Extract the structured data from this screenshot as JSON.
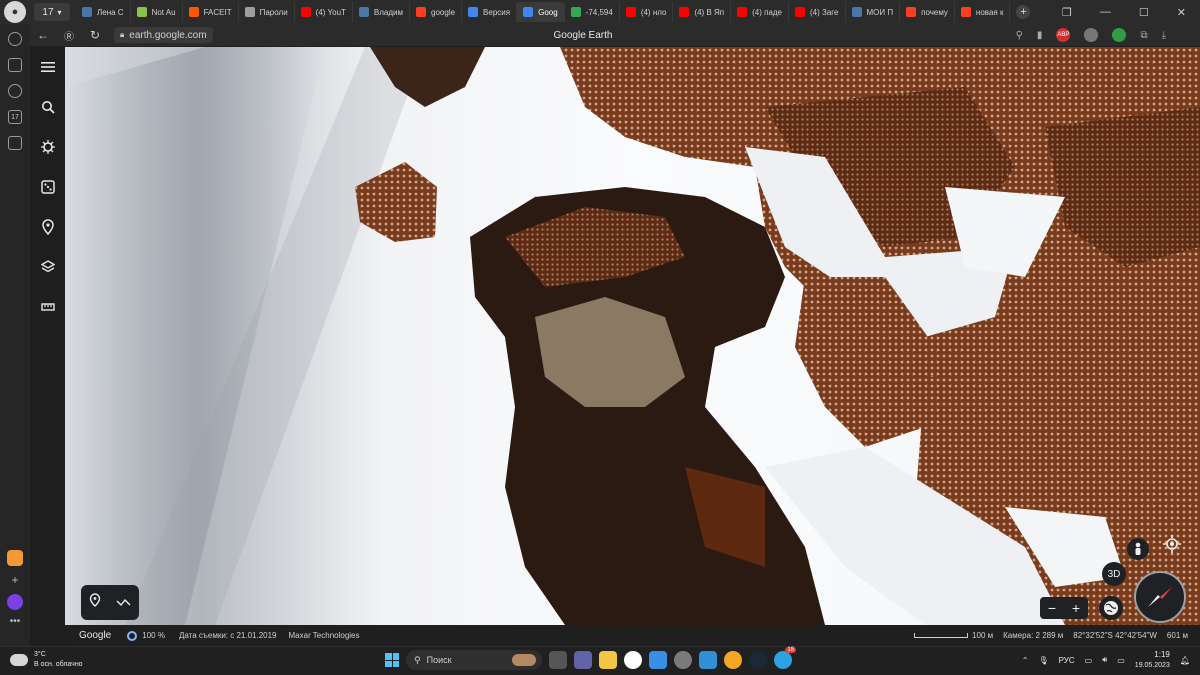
{
  "browser": {
    "tab_count": "17",
    "tabs": [
      {
        "label": "Лена С",
        "color": "#4a76a8"
      },
      {
        "label": "Not Au",
        "color": "#8bc34a"
      },
      {
        "label": "FACEIT",
        "color": "#ff5500"
      },
      {
        "label": "Пароли",
        "color": "#9e9e9e"
      },
      {
        "label": "(4) YouT",
        "color": "#ff0000"
      },
      {
        "label": "Владим",
        "color": "#4a76a8"
      },
      {
        "label": "google",
        "color": "#fc3f1d"
      },
      {
        "label": "Версия",
        "color": "#4285f4"
      },
      {
        "label": "Goog",
        "color": "#4285f4",
        "active": true
      },
      {
        "label": "-74,594",
        "color": "#34a853"
      },
      {
        "label": "(4) нло",
        "color": "#ff0000"
      },
      {
        "label": "(4) В Яп",
        "color": "#ff0000"
      },
      {
        "label": "(4) паде",
        "color": "#ff0000"
      },
      {
        "label": "(4) Заге",
        "color": "#ff0000"
      },
      {
        "label": "МОИ П",
        "color": "#4a76a8"
      },
      {
        "label": "почему",
        "color": "#fc3f1d"
      },
      {
        "label": "новая к",
        "color": "#fc3f1d"
      }
    ],
    "url": "earth.google.com",
    "page_title": "Google Earth",
    "ext_abp": "ABP",
    "sidebar_badge": "17"
  },
  "earth": {
    "brand": "Google",
    "progress": "100 %",
    "capture_date": "Дата съемки: с 21.01.2019",
    "provider": "Maxar Technologies",
    "scale": "100 м",
    "camera": "Камера: 2 289 м",
    "coords": "82°32'52\"S 42°42'54\"W",
    "altitude": "601 м",
    "btn_3d": "3D",
    "zoom_out": "−",
    "zoom_in": "+"
  },
  "taskbar": {
    "temperature": "3°C",
    "weather_desc": "В осн. облачно",
    "search_placeholder": "Поиск",
    "telegram_badge": "18",
    "language": "РУС",
    "time": "1:19",
    "date": "19.05.2023"
  }
}
